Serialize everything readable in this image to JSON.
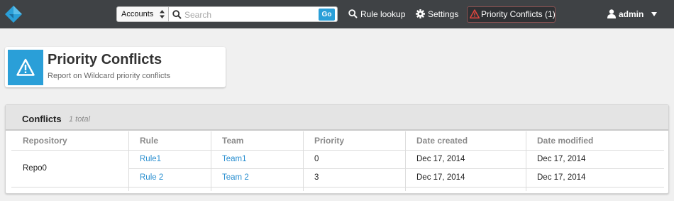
{
  "nav": {
    "logo": "diamond-logo-icon",
    "account_select": "Accounts",
    "search_placeholder": "Search",
    "go_label": "Go",
    "rule_lookup": "Rule lookup",
    "settings": "Settings",
    "priority_conflicts": "Priority Conflicts (1)",
    "user": "admin"
  },
  "header": {
    "title": "Priority Conflicts",
    "subtitle": "Report on Wildcard priority conflicts",
    "icon": "warning-icon"
  },
  "panel": {
    "title": "Conflicts",
    "count": "1 total",
    "columns": [
      "Repository",
      "Rule",
      "Team",
      "Priority",
      "Date created",
      "Date modified"
    ],
    "repository": "Repo0",
    "rows": [
      {
        "rule": "Rule1",
        "team": "Team1",
        "priority": "0",
        "created": "Dec 17, 2014",
        "modified": "Dec 17, 2014"
      },
      {
        "rule": "Rule 2",
        "team": "Team 2",
        "priority": "3",
        "created": "Dec 17, 2014",
        "modified": "Dec 17, 2014"
      }
    ]
  },
  "colors": {
    "topbar": "#3f4245",
    "accent": "#2a9fd8",
    "link": "#2a8fd0",
    "alert": "#e0463e"
  }
}
